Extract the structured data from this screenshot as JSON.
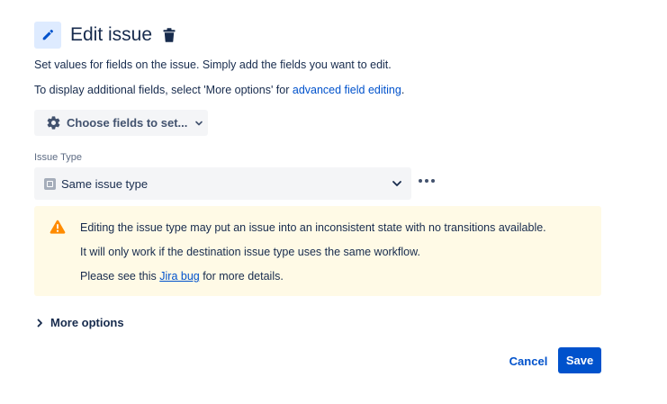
{
  "header": {
    "title": "Edit issue",
    "edit_icon": "pencil-icon",
    "delete_icon": "trash-icon"
  },
  "description": {
    "line1": "Set values for fields on the issue. Simply add the fields you want to edit.",
    "line2_prefix": "To display additional fields, select 'More options' for ",
    "line2_link": "advanced field editing",
    "line2_suffix": "."
  },
  "choose_fields": {
    "label": "Choose fields to set...",
    "icon": "gear-icon",
    "chevron": "chevron-down-icon"
  },
  "issue_type_field": {
    "label": "Issue Type",
    "value": "Same issue type",
    "icon": "issue-type-icon"
  },
  "warning": {
    "icon": "warning-icon",
    "line1": "Editing the issue type may put an issue into an inconsistent state with no transitions available.",
    "line2": "It will only work if the destination issue type uses the same workflow.",
    "line3_prefix": "Please see this ",
    "line3_link": "Jira bug",
    "line3_suffix": " for more details."
  },
  "more_options": {
    "label": "More options",
    "icon": "chevron-right-icon"
  },
  "footer": {
    "cancel_label": "Cancel",
    "save_label": "Save"
  },
  "colors": {
    "primary": "#0052cc",
    "text": "#172b4d",
    "warning_bg": "#fffae6",
    "warning_icon": "#ff8b00",
    "field_bg": "#f4f5f7"
  }
}
